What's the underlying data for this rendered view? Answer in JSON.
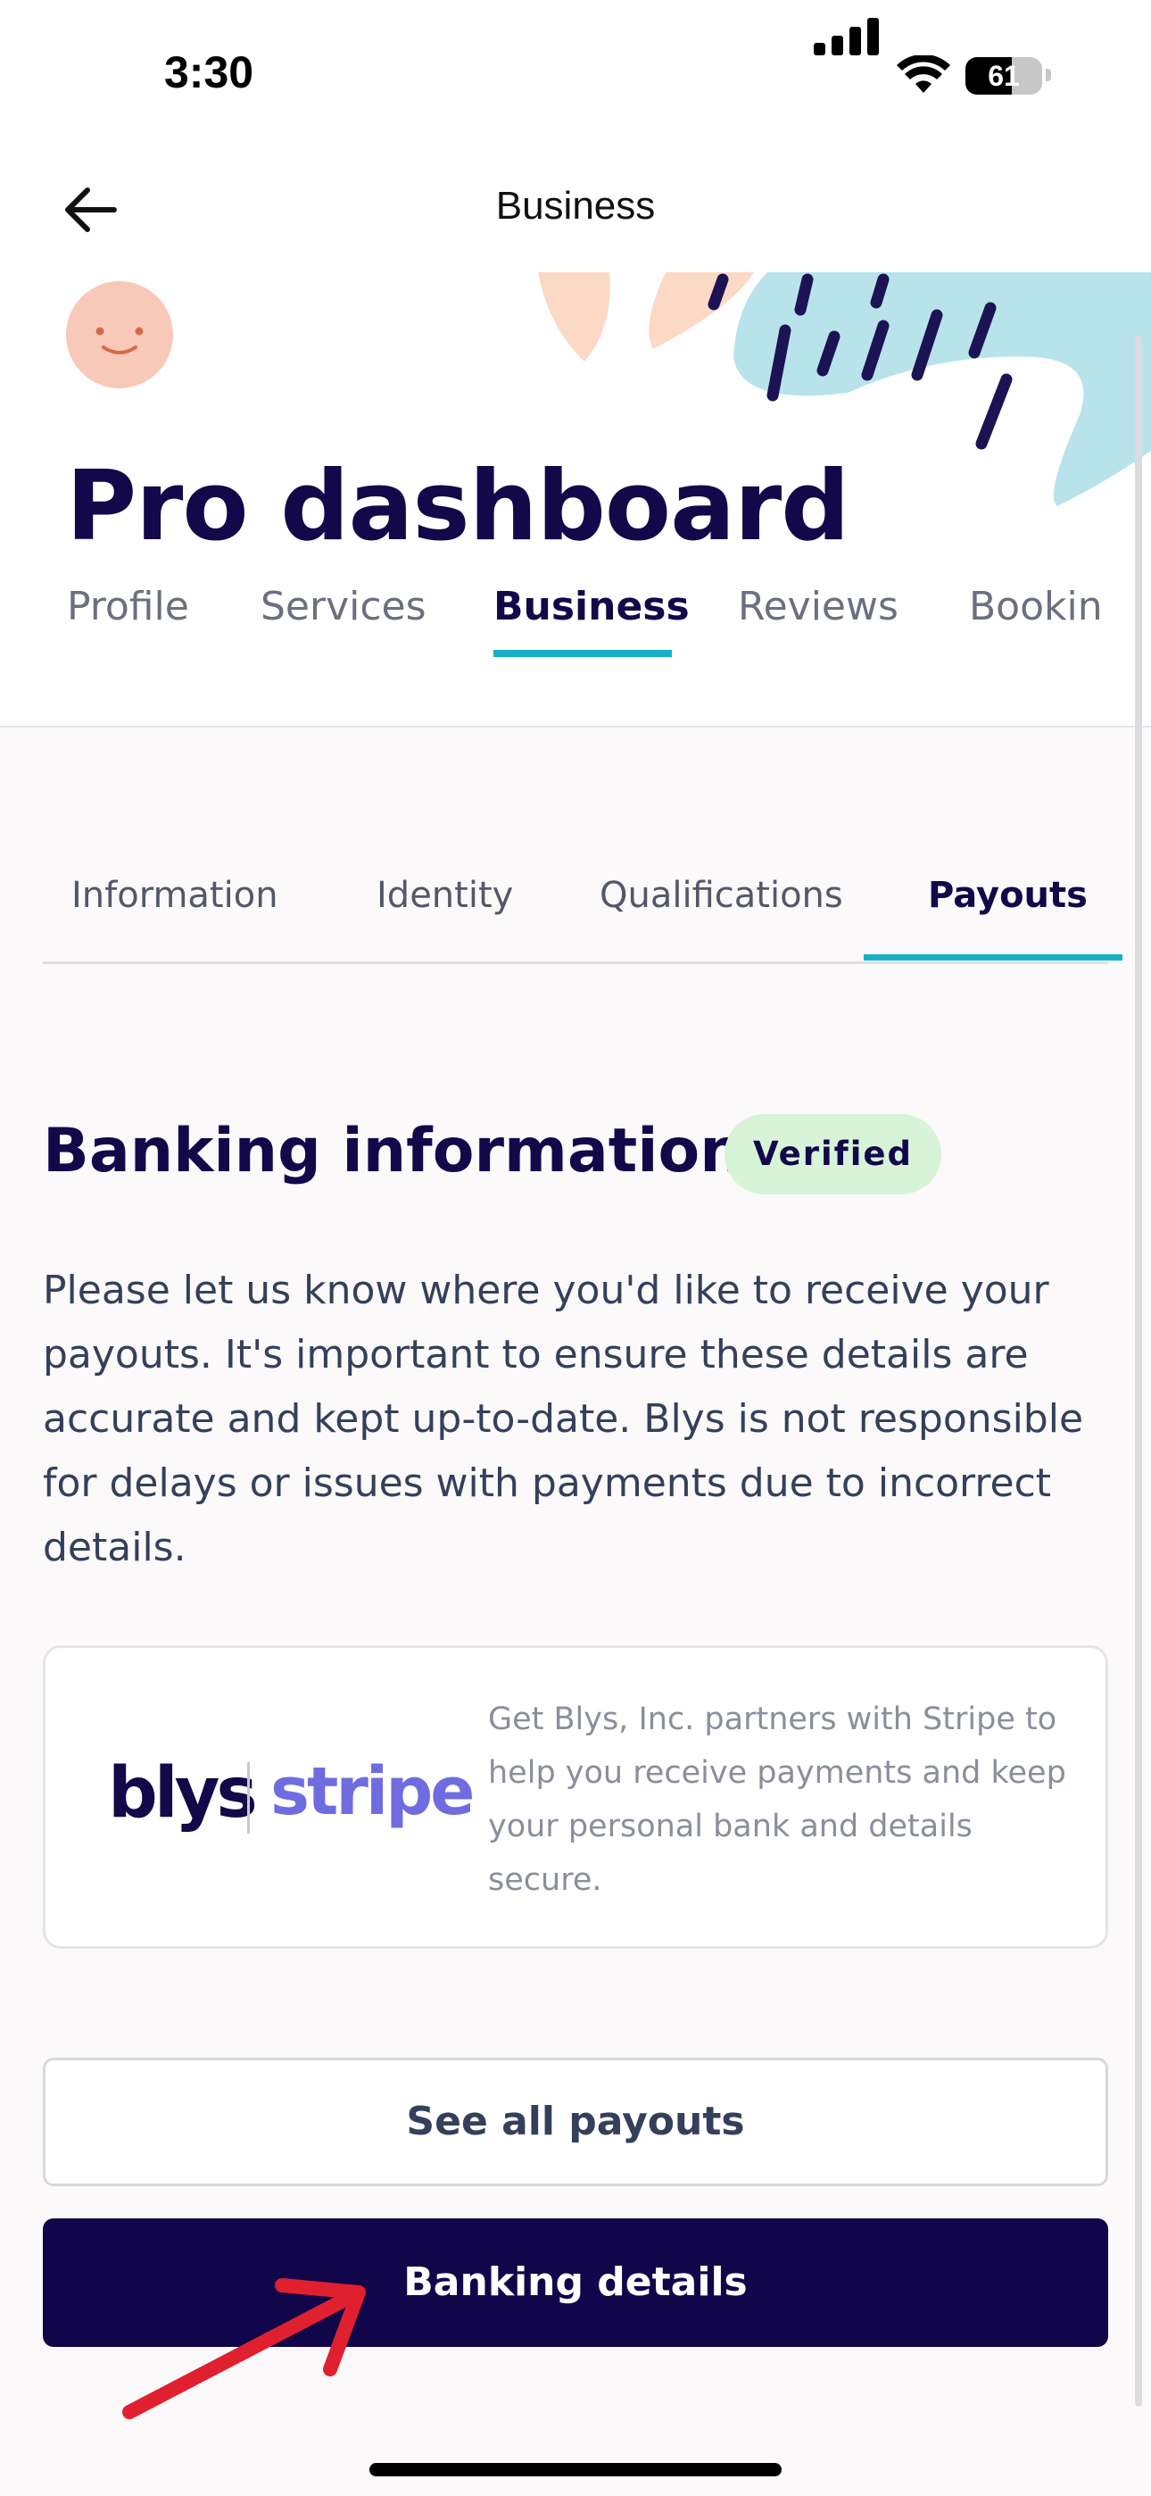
{
  "status_bar": {
    "time": "3:30",
    "battery": "61",
    "battery_level": 0.61
  },
  "nav": {
    "title": "Business"
  },
  "header": {
    "page_title": "Pro dashboard"
  },
  "main_tabs": [
    {
      "label": "Profile",
      "active": false
    },
    {
      "label": "Services",
      "active": false
    },
    {
      "label": "Business",
      "active": true
    },
    {
      "label": "Reviews",
      "active": false
    },
    {
      "label": "Bookin",
      "active": false
    }
  ],
  "sub_tabs": [
    {
      "label": "Information",
      "active": false
    },
    {
      "label": "Identity",
      "active": false
    },
    {
      "label": "Qualifications",
      "active": false
    },
    {
      "label": "Payouts",
      "active": true
    }
  ],
  "banking": {
    "title": "Banking information",
    "badge": "Verified",
    "description": "Please let us know where you'd like to receive your payouts. It's important to ensure these details are accurate and kept up-to-date. Blys is not responsible for delays or issues with payments due to incorrect details."
  },
  "stripe_card": {
    "logo_blys": "blys",
    "logo_stripe": "stripe",
    "text": "Get Blys, Inc. partners with Stripe to help you receive payments and keep your personal bank and details secure."
  },
  "buttons": {
    "see_payouts": "See all payouts",
    "banking_details": "Banking details"
  },
  "colors": {
    "brand_navy": "#12064a",
    "accent_teal": "#17b1c7",
    "verified_bg": "#d8f4d8",
    "stripe_purple": "#6f6ce0",
    "annotation_red": "#e0202e"
  }
}
